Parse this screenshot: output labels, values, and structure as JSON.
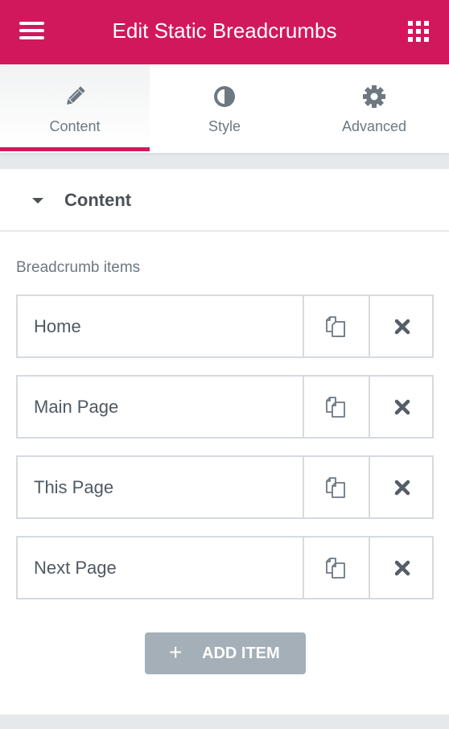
{
  "header": {
    "title": "Edit Static Breadcrumbs",
    "menu_icon": "hamburger-icon",
    "apps_icon": "grid-icon",
    "accent_color": "#d2185d"
  },
  "tabs": [
    {
      "label": "Content",
      "icon": "pencil-icon",
      "active": true
    },
    {
      "label": "Style",
      "icon": "contrast-icon",
      "active": false
    },
    {
      "label": "Advanced",
      "icon": "gear-icon",
      "active": false
    }
  ],
  "section": {
    "title": "Content",
    "expanded": true
  },
  "repeater": {
    "label": "Breadcrumb items",
    "items": [
      {
        "label": "Home"
      },
      {
        "label": "Main Page"
      },
      {
        "label": "This Page"
      },
      {
        "label": "Next Page"
      }
    ],
    "duplicate_icon": "copy-icon",
    "remove_icon": "close-icon",
    "add_button": {
      "icon": "+",
      "label": "ADD ITEM"
    }
  }
}
